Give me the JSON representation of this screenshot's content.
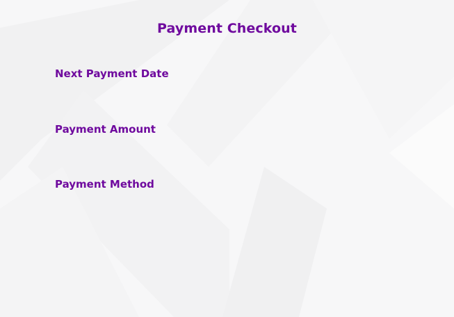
{
  "page": {
    "title": "Payment Checkout"
  },
  "fields": [
    {
      "label": "Next Payment Date"
    },
    {
      "label": "Payment Amount"
    },
    {
      "label": "Payment Method"
    }
  ],
  "colors": {
    "accent": "#6f0a9e",
    "background": "#f7f7f8"
  }
}
